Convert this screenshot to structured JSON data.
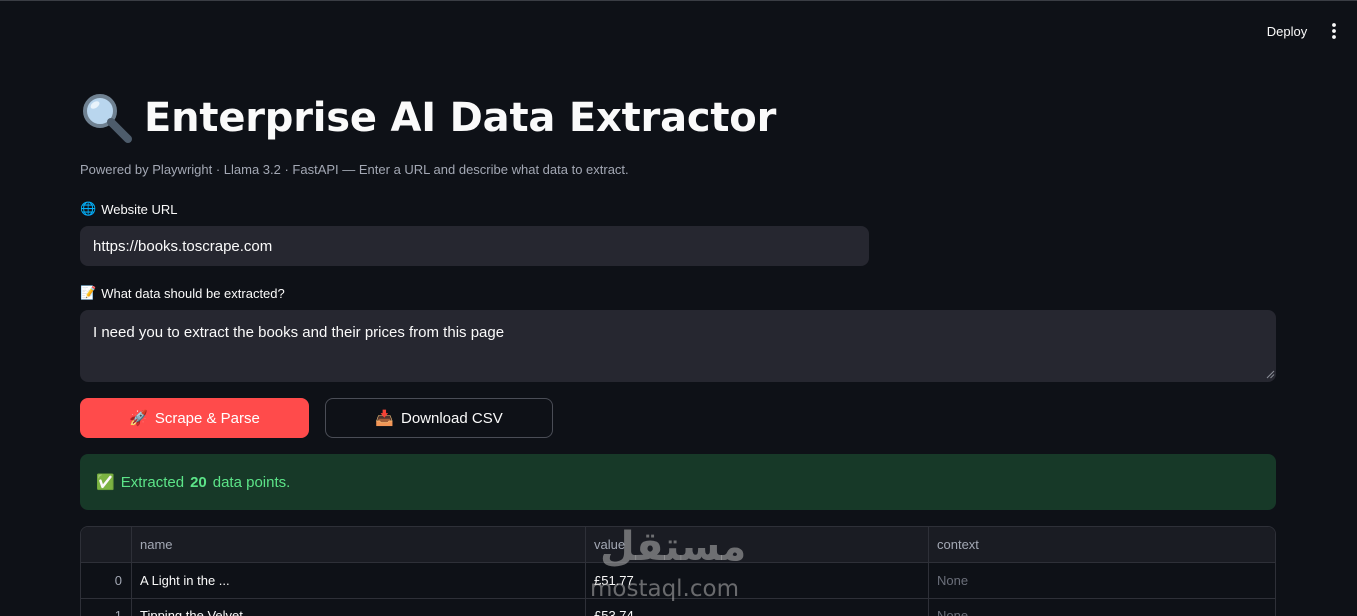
{
  "header": {
    "deploy_label": "Deploy"
  },
  "page": {
    "title": "Enterprise AI Data Extractor",
    "subtitle": "Powered by Playwright · Llama 3.2 · FastAPI — Enter a URL and describe what data to extract."
  },
  "form": {
    "url_label_icon": "🌐",
    "url_label": "Website URL",
    "url_value": "https://books.toscrape.com",
    "prompt_label_icon": "📝",
    "prompt_label": "What data should be extracted?",
    "prompt_value": "I need you to extract the books and their prices from this page"
  },
  "actions": {
    "scrape_icon": "🚀",
    "scrape_label": "Scrape & Parse",
    "download_icon": "📥",
    "download_label": "Download CSV"
  },
  "status": {
    "icon": "✅",
    "prefix": "Extracted",
    "count": "20",
    "suffix": "data points."
  },
  "table": {
    "columns": [
      "",
      "name",
      "value",
      "context"
    ],
    "rows": [
      {
        "index": "0",
        "name": "A Light in the ...",
        "value": "£51.77",
        "context": "None"
      },
      {
        "index": "1",
        "name": "Tipping the Velvet",
        "value": "£53.74",
        "context": "None"
      }
    ]
  },
  "watermark": {
    "arabic": "مستقل",
    "latin": "mostaql.com"
  },
  "colors": {
    "background": "#0e1117",
    "input_bg": "#262730",
    "primary": "#ff4b4b",
    "success_bg": "#173928",
    "success_text": "#5ce488"
  },
  "icons": {
    "title": "magnifying-glass-icon",
    "menu": "vertical-ellipsis-icon"
  }
}
